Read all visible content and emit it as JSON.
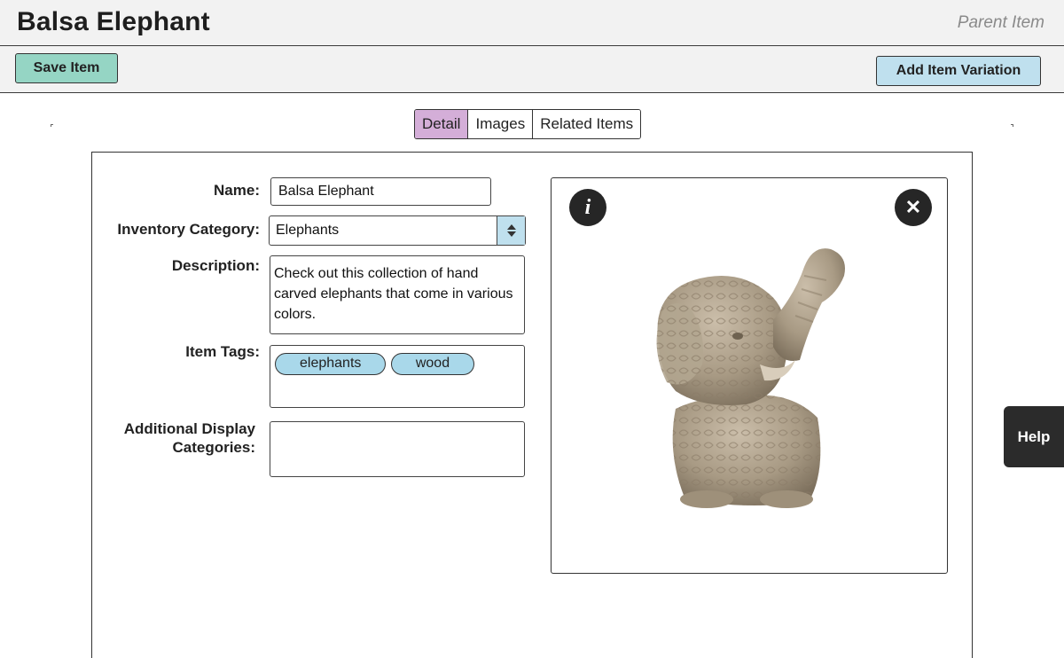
{
  "header": {
    "title": "Balsa Elephant",
    "subtitle": "Parent Item"
  },
  "toolbar": {
    "save_label": "Save Item",
    "variation_label": "Add Item Variation"
  },
  "tabs": [
    {
      "label": "Detail",
      "active": true
    },
    {
      "label": "Images",
      "active": false
    },
    {
      "label": "Related Items",
      "active": false
    }
  ],
  "form": {
    "name_label": "Name:",
    "name_value": "Balsa Elephant",
    "category_label": "Inventory Category:",
    "category_value": "Elephants",
    "description_label": "Description:",
    "description_value": "Check out this collection of hand carved elephants that come in various colors.",
    "tags_label": "Item Tags:",
    "tags": [
      "elephants",
      "wood"
    ],
    "additional_label_line1": "Additional Display",
    "additional_label_line2": "Categories:",
    "additional_value": ""
  },
  "image_panel": {
    "info_icon": "i",
    "close_icon": "✕",
    "image_subject": "carved elephant figurine"
  },
  "help": {
    "label": "Help"
  },
  "colors": {
    "header_bg": "#f2f2f2",
    "save_button": "#95d5c4",
    "variation_button": "#bfe0ee",
    "active_tab": "#d4aed8",
    "tag_bg": "#a9d8ea",
    "help_bg": "#2b2b2b"
  }
}
